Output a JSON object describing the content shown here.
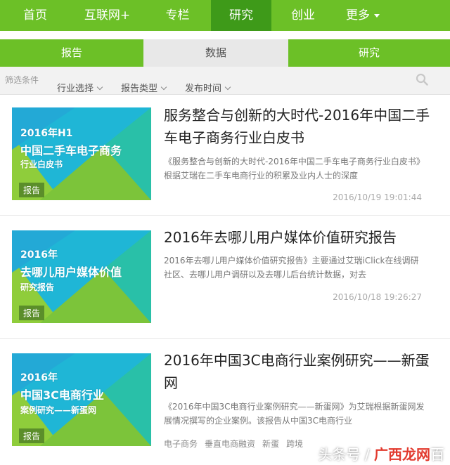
{
  "topnav": {
    "items": [
      "首页",
      "互联网+",
      "专栏",
      "研究",
      "创业",
      "更多"
    ],
    "active_index": 3
  },
  "tabs": [
    "报告",
    "数据",
    "研究"
  ],
  "filter": {
    "label": "筛选条件",
    "dropdowns": [
      "行业选择",
      "报告类型",
      "发布时间"
    ]
  },
  "articles": [
    {
      "thumb_lines": [
        "2016年H1",
        "中国二手车电子商务",
        "行业白皮书"
      ],
      "badge": "报告",
      "title": "服务整合与创新的大时代-2016年中国二手车电子商务行业白皮书",
      "summary": "《服务整合与创新的大时代-2016年中国二手车电子商务行业白皮书》根据艾瑞在二手车电商行业的积累及业内人士的深度",
      "time": "2016/10/19 19:01:44"
    },
    {
      "thumb_lines": [
        "2016年",
        "去哪儿用户媒体价值",
        "研究报告"
      ],
      "badge": "报告",
      "title": "2016年去哪儿用户媒体价值研究报告",
      "summary": "2016年去哪儿用户媒体价值研究报告》主要通过艾瑞iClick在线调研社区、去哪儿用户调研以及去哪儿后台统计数据，对去",
      "time": "2016/10/18 19:26:27"
    },
    {
      "thumb_lines": [
        "2016年",
        "中国3C电商行业",
        "案例研究——新蛋网"
      ],
      "badge": "报告",
      "title": "2016年中国3C电商行业案例研究——新蛋网",
      "summary": "《2016年中国3C电商行业案例研究——新蛋网》为艾瑞根据新蛋网发展情况撰写的企业案例。该报告从中国3C电商行业",
      "tags": [
        "电子商务",
        "垂直电商融资",
        "新蛋",
        "跨境"
      ]
    }
  ],
  "watermark": {
    "prefix": "头条号 / ",
    "brand": "广西龙网",
    "suffix": "百"
  }
}
